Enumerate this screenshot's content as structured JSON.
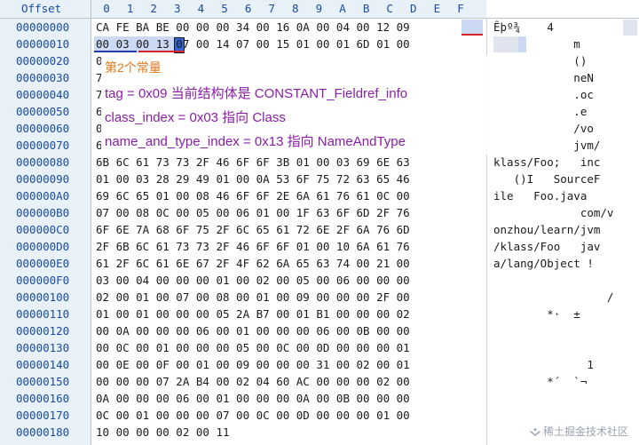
{
  "header": {
    "offset_label": "Offset",
    "columns": [
      "0",
      "1",
      "2",
      "3",
      "4",
      "5",
      "6",
      "7",
      "8",
      "9",
      "A",
      "B",
      "C",
      "D",
      "E",
      "F"
    ]
  },
  "rows": [
    {
      "offset": "00000000",
      "hex": "CA FE BA BE 00 00 00 34 00 16 0A 00 04 00 12 09",
      "ascii": "Êþº¾    4"
    },
    {
      "offset": "00000010",
      "hex": "00 03 00 13 07 00 14 07 00 15 01 00 01 6D 01 00",
      "ascii": "            m"
    },
    {
      "offset": "00000020",
      "hex": "0",
      "ascii": "            ()"
    },
    {
      "offset": "00000030",
      "hex": "7",
      "ascii": "            neN"
    },
    {
      "offset": "00000040",
      "hex": "7",
      "ascii": "            .oc"
    },
    {
      "offset": "00000050",
      "hex": "6",
      "ascii": "            .e"
    },
    {
      "offset": "00000060",
      "hex": "0",
      "ascii": "            /vo"
    },
    {
      "offset": "00000070",
      "hex": "6",
      "ascii": "            jvm/"
    },
    {
      "offset": "00000080",
      "hex": "6B 6C 61 73 73 2F 46 6F 6F 3B 01 00 03 69 6E 63",
      "ascii": "klass/Foo;   inc"
    },
    {
      "offset": "00000090",
      "hex": "01 00 03 28 29 49 01 00 0A 53 6F 75 72 63 65 46",
      "ascii": "   ()I   SourceF"
    },
    {
      "offset": "000000A0",
      "hex": "69 6C 65 01 00 08 46 6F 6F 2E 6A 61 76 61 0C 00",
      "ascii": "ile   Foo.java"
    },
    {
      "offset": "000000B0",
      "hex": "07 00 08 0C 00 05 00 06 01 00 1F 63 6F 6D 2F 76",
      "ascii": "             com/v"
    },
    {
      "offset": "000000C0",
      "hex": "6F 6E 7A 68 6F 75 2F 6C 65 61 72 6E 2F 6A 76 6D",
      "ascii": "onzhou/learn/jvm"
    },
    {
      "offset": "000000D0",
      "hex": "2F 6B 6C 61 73 73 2F 46 6F 6F 01 00 10 6A 61 76",
      "ascii": "/klass/Foo   jav"
    },
    {
      "offset": "000000E0",
      "hex": "61 2F 6C 61 6E 67 2F 4F 62 6A 65 63 74 00 21 00",
      "ascii": "a/lang/Object !"
    },
    {
      "offset": "000000F0",
      "hex": "03 00 04 00 00 00 01 00 02 00 05 00 06 00 00 00",
      "ascii": ""
    },
    {
      "offset": "00000100",
      "hex": "02 00 01 00 07 00 08 00 01 00 09 00 00 00 2F 00",
      "ascii": "                 /"
    },
    {
      "offset": "00000110",
      "hex": "01 00 01 00 00 00 05 2A B7 00 01 B1 00 00 00 02",
      "ascii": "        *·  ±"
    },
    {
      "offset": "00000120",
      "hex": "00 0A 00 00 00 06 00 01 00 00 00 06 00 0B 00 00",
      "ascii": ""
    },
    {
      "offset": "00000130",
      "hex": "00 0C 00 01 00 00 00 05 00 0C 00 0D 00 00 00 01",
      "ascii": ""
    },
    {
      "offset": "00000140",
      "hex": "00 0E 00 0F 00 01 00 09 00 00 00 31 00 02 00 01",
      "ascii": "              1"
    },
    {
      "offset": "00000150",
      "hex": "00 00 00 07 2A B4 00 02 04 60 AC 00 00 00 02 00",
      "ascii": "        *´  `¬"
    },
    {
      "offset": "00000160",
      "hex": "0A 00 00 00 06 00 01 00 00 00 0A 00 0B 00 00 00",
      "ascii": ""
    },
    {
      "offset": "00000170",
      "hex": "0C 00 01 00 00 00 07 00 0C 00 0D 00 00 00 01 00",
      "ascii": ""
    },
    {
      "offset": "00000180",
      "hex": "10 00 00 00 02 00 11",
      "ascii": ""
    }
  ],
  "annotation": {
    "title": "第2个常量",
    "lines": [
      "tag = 0x09 当前结构体是 CONSTANT_Fieldref_info",
      "class_index = 0x03 指向 Class",
      "name_and_type_index = 0x13 指向 NameAndType"
    ]
  },
  "watermark": "稀土掘金技术社区",
  "colors": {
    "offset_text": "#1a4ca0",
    "annotation_title": "#e07a1f",
    "annotation_text": "#8a1ea6",
    "underline_tag": "#d8232a",
    "underline_index": "#1f3fb0",
    "selection": "#ccd9f5"
  }
}
